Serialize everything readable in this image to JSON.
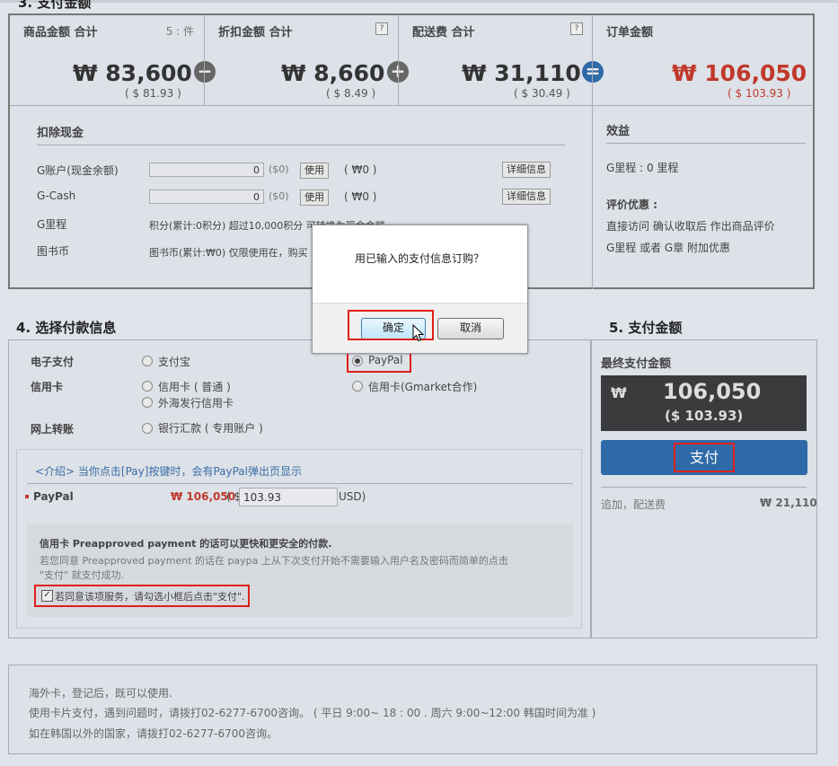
{
  "sections": {
    "summary_title": "3. 支付金额",
    "payinfo_title": "4. 选择付款信息",
    "final_title": "5. 支付金额"
  },
  "summary": {
    "goods_head": "商品金额 合计",
    "goods_count": "5 : 件",
    "goods_amount": "₩ 83,600",
    "goods_usd": "( $ 81.93 )",
    "discount_head": "折扣金额 合计",
    "discount_amount": "₩ 8,660",
    "discount_usd": "( $ 8.49 )",
    "shipping_head": "配送费 合计",
    "shipping_amount": "₩ 31,110",
    "shipping_usd": "( $ 30.49 )",
    "order_head": "订单金额",
    "order_amount": "₩ 106,050",
    "order_usd": "( $ 103.93 )",
    "qmark": "?",
    "op_minus": "−",
    "op_plus": "+",
    "op_equal": "="
  },
  "deduct": {
    "title": "扣除现金",
    "rows": [
      {
        "label": "G账户(现金余额)",
        "value": "0",
        "usd": "($0)",
        "btn": "使用",
        "won": "( ₩0 )",
        "detail": "详细信息"
      },
      {
        "label": "G-Cash",
        "value": "0",
        "usd": "($0)",
        "btn": "使用",
        "won": "( ₩0 )",
        "detail": "详细信息"
      }
    ],
    "gmile_label": "G里程",
    "gmile_text": "积分(累计:0积分) 超过10,000积分 可转换为现金金额",
    "book_label": "图书币",
    "book_text": "图书币(累计:₩0) 仅限使用在，购买"
  },
  "benefit": {
    "title": "效益",
    "gmile": "G里程 : 0 里程",
    "review_title": "评价优惠 :",
    "review_1": "直接访问 确认收取后 作出商品评价",
    "review_2": "G里程 或者 G章 附加优惠"
  },
  "payinfo": {
    "epay_label": "电子支付",
    "alipay": "支付宝",
    "paypal": "PayPal",
    "card_label": "信用卡",
    "card_normal": "信用卡 ( 普通 )",
    "card_overseas": "外海发行信用卡",
    "card_gmarket": "信用卡(Gmarket合作)",
    "bank_label": "网上转账",
    "bank_transfer": "银行汇款 ( 专用账户 )",
    "intro": "<介绍> 当你点击[Pay]按键时，会有PayPal弹出页显示",
    "paypal_row_label": "PayPal",
    "paypal_won": "₩ 106,050",
    "paypal_usd_prefix": "( $",
    "paypal_usd_value": "103.93",
    "paypal_usd_suffix": "USD)",
    "note_title": "信用卡 Preapproved payment 的话可以更快和更安全的付款.",
    "note_line1": "若您同意 Preapproved payment 的话在 paypa 上从下次支付开始不需要输入用户名及密码而简单的点击",
    "note_line2": "\"支付\" 就支付成功.",
    "agree_text": "若同意该项服务，请勾选小框后点击\"支付\"."
  },
  "final": {
    "label": "最终支付金额",
    "won_symbol": "₩",
    "won_amount": "106,050",
    "usd_amount": "($ 103.93)",
    "pay_button": "支付",
    "extra_label": "追加，配送费",
    "extra_amount": "₩ 21,110"
  },
  "footer": {
    "line1": "海外卡，登记后，既可以使用.",
    "line2": "使用卡片支付，遇到问题时，请拨打02-6277-6700咨询。 ( 平日 9:00~ 18 : 00 . 周六 9:00~12:00 韩国时间为准 )",
    "line3": "如在韩国以外的国家，请拨打02-6277-6700咨询。"
  },
  "dialog": {
    "message": "用已输入的支付信息订购？",
    "ok": "确定",
    "cancel": "取消"
  },
  "colors": {
    "highlight_red": "#e0201a",
    "order_red": "#c0392b",
    "pay_blue": "#2f6aa8"
  }
}
